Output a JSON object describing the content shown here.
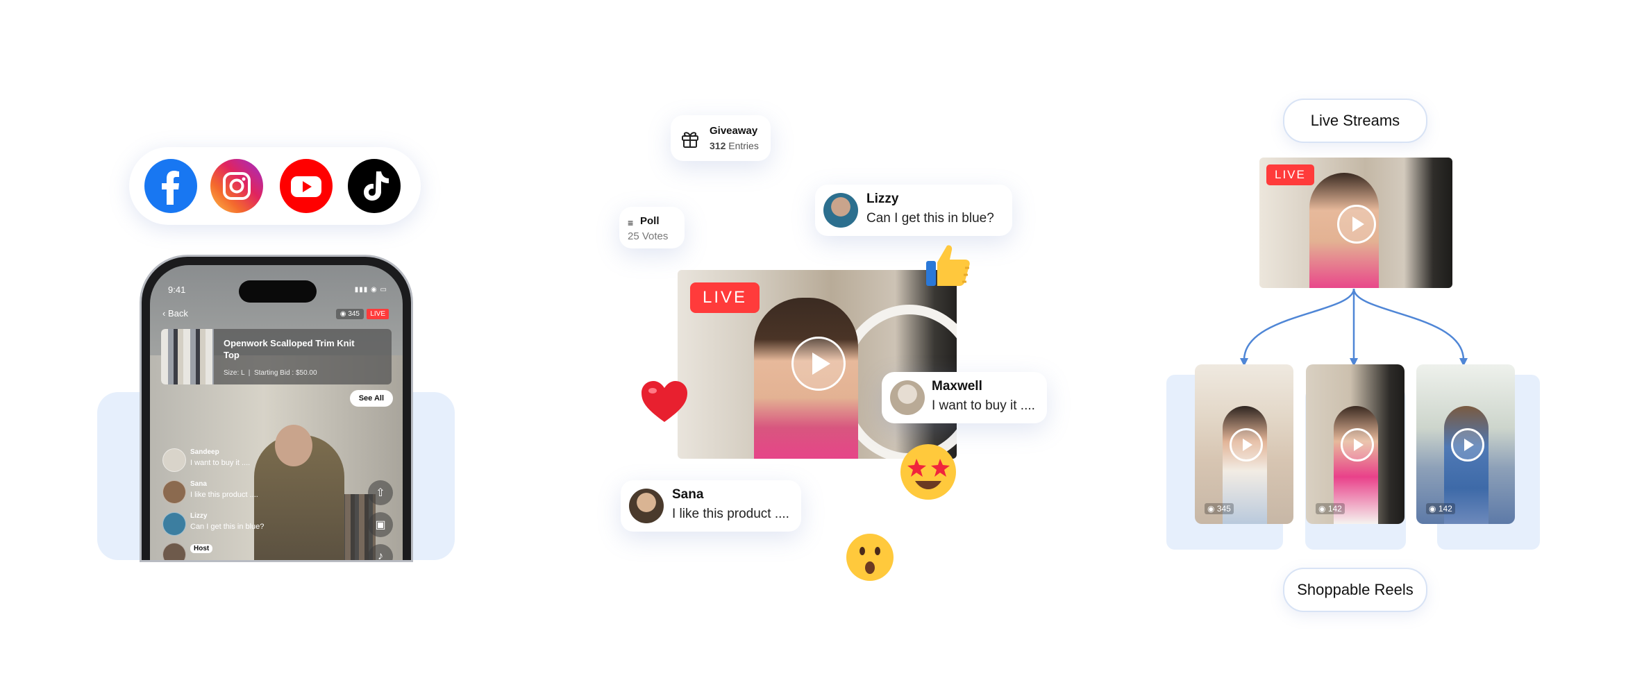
{
  "social": {
    "platforms": [
      {
        "name": "facebook-icon",
        "color": "#1877f2"
      },
      {
        "name": "instagram-icon",
        "color": "#e0245f"
      },
      {
        "name": "youtube-icon",
        "color": "#ff0000"
      },
      {
        "name": "tiktok-icon",
        "color": "#000000"
      }
    ]
  },
  "phone": {
    "time": "9:41",
    "back_label": "Back",
    "viewers": "345",
    "live_badge": "LIVE",
    "product": {
      "title": "Openwork Scalloped Trim Knit Top",
      "size": "Size: L",
      "separator": "|",
      "starting_bid": "Starting Bid : $50.00"
    },
    "see_all": "See All",
    "comments": [
      {
        "name": "Sandeep",
        "text": "I want to buy it ...."
      },
      {
        "name": "Sana",
        "text": "I like this product ...."
      },
      {
        "name": "Lizzy",
        "text": "Can I get this in blue?"
      }
    ],
    "host_badge": "Host"
  },
  "middle": {
    "giveaway": {
      "title": "Giveaway",
      "count": "312",
      "unit": "Entries"
    },
    "poll": {
      "title": "Poll",
      "votes": "25 Votes"
    },
    "live_badge": "LIVE",
    "chats": {
      "lizzy": {
        "name": "Lizzy",
        "text": "Can I get this in blue?"
      },
      "maxwell": {
        "name": "Maxwell",
        "text": "I want to buy it ...."
      },
      "sana": {
        "name": "Sana",
        "text": "I like this product ...."
      }
    },
    "reactions": [
      "thumbs-up-icon",
      "heart-icon",
      "star-struck-icon",
      "surprised-icon"
    ]
  },
  "right": {
    "live_streams_label": "Live Streams",
    "live_badge": "LIVE",
    "reels": [
      {
        "views": "345"
      },
      {
        "views": "142"
      },
      {
        "views": "142"
      }
    ],
    "shoppable_reels_label": "Shoppable Reels"
  },
  "colors": {
    "live_red": "#ff3b3b",
    "panel_blue": "#e6effc",
    "flow_line": "#4f86d6"
  }
}
